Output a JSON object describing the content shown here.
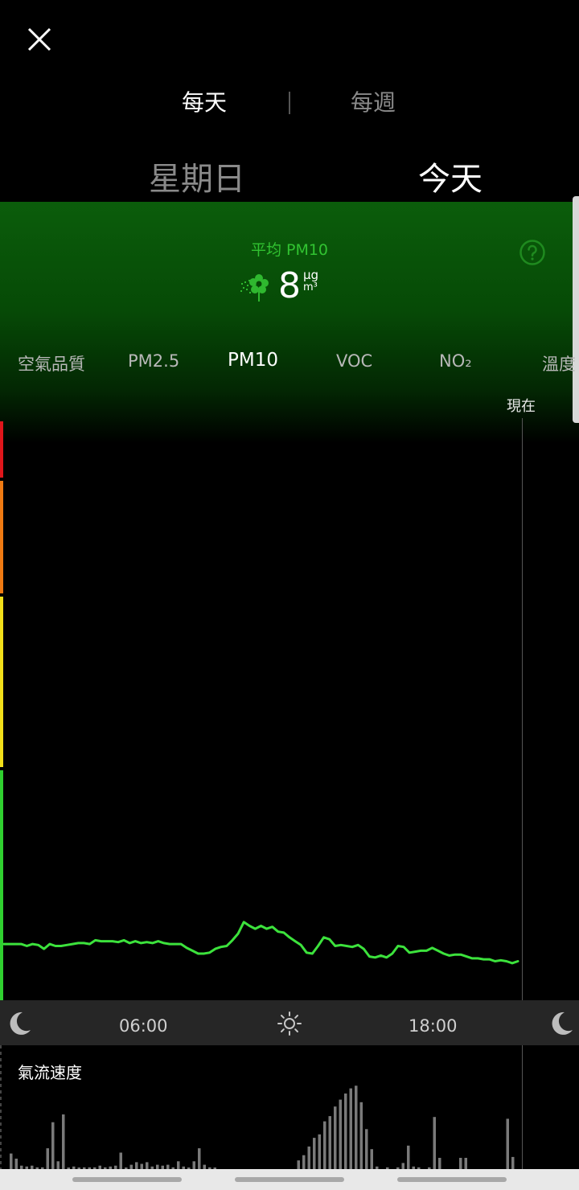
{
  "header": {
    "period_tabs": [
      {
        "label": "每天",
        "selected": true
      },
      {
        "label": "每週",
        "selected": false
      }
    ],
    "days": [
      {
        "label": "星期日",
        "selected": false
      },
      {
        "label": "今天",
        "selected": true
      }
    ]
  },
  "summary": {
    "avg_label": "平均 PM10",
    "value": "8",
    "unit_top": "μg",
    "unit_bottom": "m³",
    "icon": "flower-icon",
    "help_icon": "question-icon"
  },
  "metric_tabs": [
    {
      "label": "空氣品質",
      "selected": false
    },
    {
      "label": "PM2.5",
      "selected": false
    },
    {
      "label": "PM10",
      "selected": true
    },
    {
      "label": "VOC",
      "selected": false
    },
    {
      "label": "NO₂",
      "selected": false
    },
    {
      "label": "溫度",
      "selected": false
    }
  ],
  "chart": {
    "now_label": "現在",
    "time_labels": [
      "06:00",
      "18:00"
    ],
    "level_colors": [
      "#e0161b",
      "#f07a12",
      "#f2df1a",
      "#2fd02f"
    ],
    "line_color": "#3ce23c",
    "series": [
      9,
      9,
      9,
      9,
      8.8,
      9,
      8.9,
      8.5,
      9,
      8.8,
      8.8,
      8.9,
      9,
      9.1,
      9.1,
      9,
      9.4,
      9.3,
      9.3,
      9.3,
      9.2,
      9.4,
      9.1,
      9.3,
      9.1,
      9.2,
      9.1,
      9.3,
      9.1,
      9,
      9,
      9,
      8.6,
      8.3,
      8,
      8,
      8.1,
      8.5,
      8.7,
      8.8,
      9.4,
      10.1,
      11.3,
      10.9,
      10.6,
      10.9,
      10.6,
      10.8,
      10.3,
      10.2,
      9.7,
      9.3,
      8.9,
      8.1,
      8,
      8.8,
      9.7,
      9.5,
      8.8,
      8.9,
      8.8,
      8.7,
      8.9,
      8.5,
      7.7,
      7.6,
      7.8,
      7.6,
      8,
      8.8,
      8.7,
      8.1,
      8.2,
      8.3,
      8.3,
      8.6,
      8.3,
      8,
      7.8,
      7.9,
      7.9,
      7.7,
      7.5,
      7.5,
      7.4,
      7.4,
      7.2,
      7.3,
      7.2,
      7,
      7.2
    ]
  },
  "airflow": {
    "label": "氣流速度",
    "bar_color": "#7a7a7a",
    "bars": [
      0.18,
      0.12,
      0.04,
      0.03,
      0.04,
      0.02,
      0.02,
      0.24,
      0.54,
      0.09,
      0.63,
      0.01,
      0.03,
      0.01,
      0.02,
      0.02,
      0.02,
      0.04,
      0.02,
      0.03,
      0.04,
      0.19,
      0.01,
      0.05,
      0.08,
      0.06,
      0.08,
      0.03,
      0.05,
      0.04,
      0.05,
      0.02,
      0.09,
      0.03,
      0.01,
      0.09,
      0.24,
      0.05,
      0.02,
      0.01,
      0,
      0,
      0,
      0,
      0,
      0,
      0,
      0,
      0,
      0,
      0,
      0,
      0,
      0,
      0,
      0.1,
      0.16,
      0.26,
      0.36,
      0.4,
      0.55,
      0.61,
      0.72,
      0.8,
      0.87,
      0.93,
      0.96,
      0.77,
      0.46,
      0.23,
      0.03,
      0,
      0.02,
      0,
      0.02,
      0.07,
      0.27,
      0.03,
      0.02,
      0,
      0.02,
      0.6,
      0.13,
      0,
      0,
      0,
      0.13,
      0.13,
      0,
      0,
      0,
      0,
      0,
      0,
      0,
      0.58,
      0.14
    ]
  }
}
